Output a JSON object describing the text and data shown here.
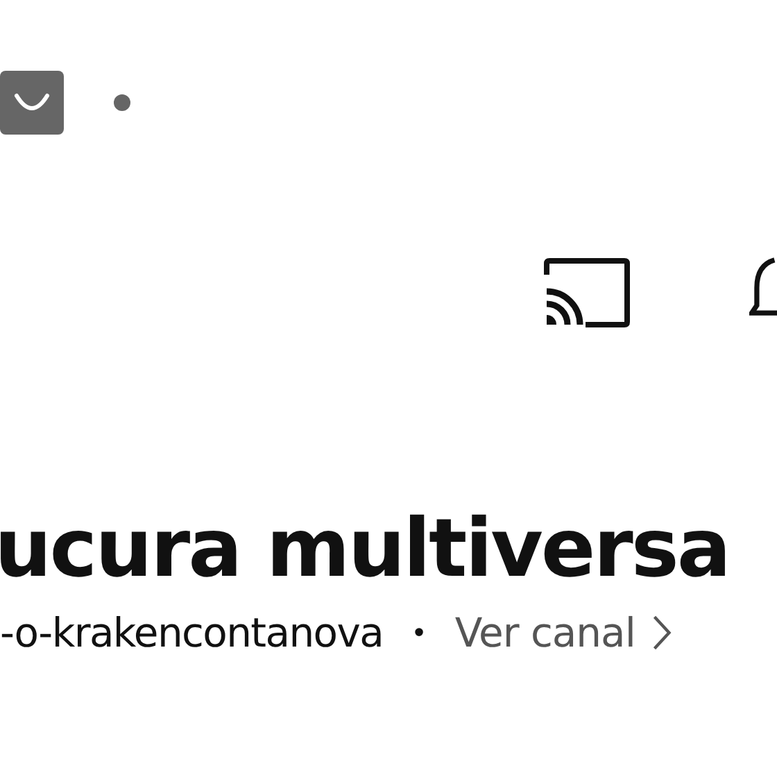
{
  "header": {
    "notification_dot": true
  },
  "video": {
    "title": "ucura multiversa",
    "channel": "-o-krakencontanova",
    "separator": "•",
    "channel_link": "Ver canal"
  }
}
